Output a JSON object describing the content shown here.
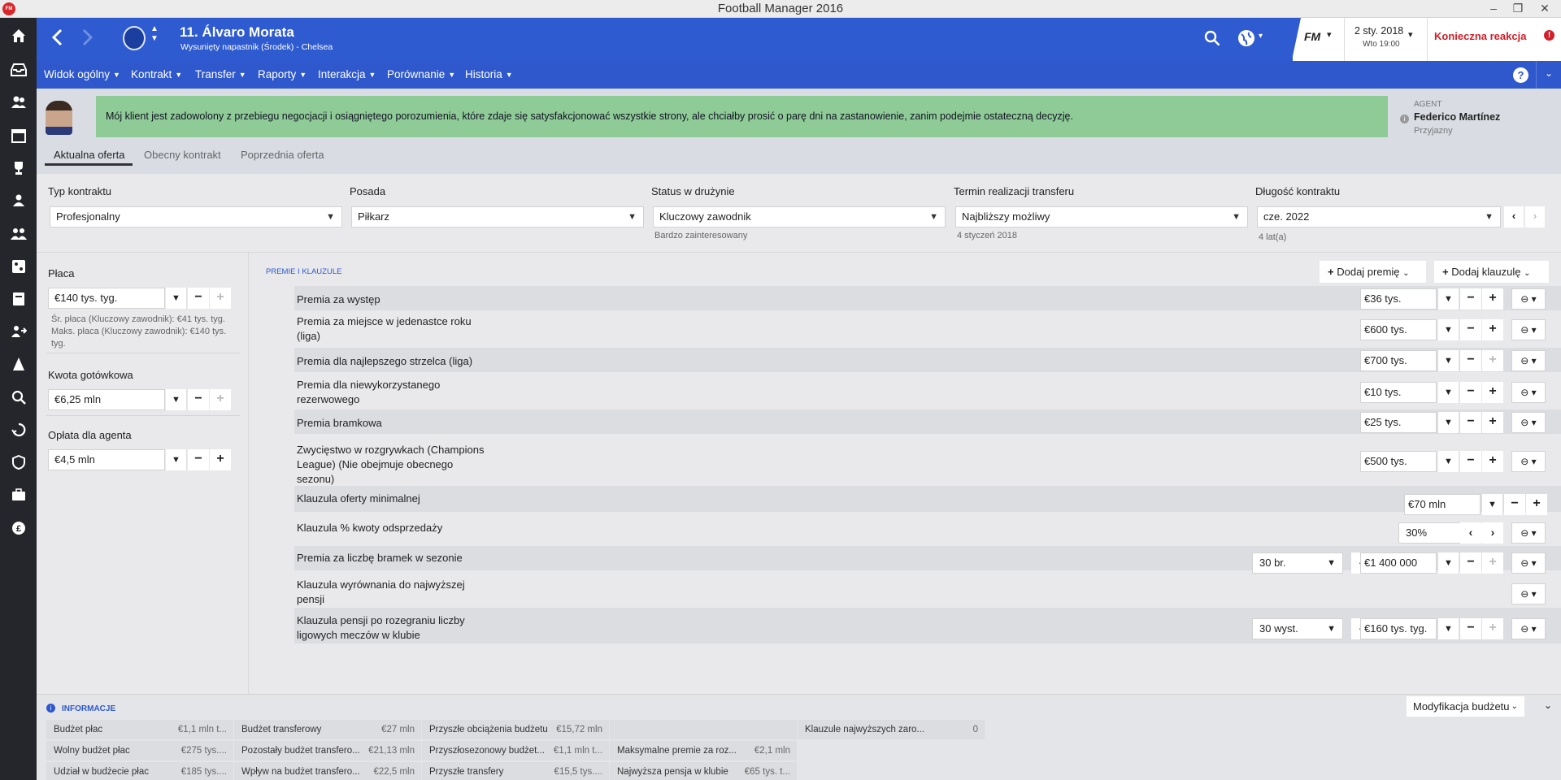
{
  "window": {
    "title": "Football Manager 2016",
    "app_icon": "FM"
  },
  "header": {
    "player_name": "11. Álvaro Morata",
    "player_sub": "Wysunięty napastnik (Środek) - Chelsea",
    "brand": "FM",
    "date": "2 sty. 2018",
    "time": "Wto 19:00",
    "alert": "Konieczna reakcja",
    "help": "?"
  },
  "nav": {
    "items": [
      "Widok ogólny",
      "Kontrakt",
      "Transfer",
      "Raporty",
      "Interakcja",
      "Porównanie",
      "Historia"
    ]
  },
  "message": {
    "text": "Mój klient jest zadowolony z przebiegu negocjacji i osiągniętego porozumienia, które zdaje się satysfakcjonować wszystkie strony, ale chciałby prosić o parę dni na zastanowienie, zanim podejmie ostateczną decyzję.",
    "agent_label": "AGENT",
    "agent_name": "Federico Martínez",
    "agent_mood": "Przyjazny"
  },
  "tabs": [
    "Aktualna oferta",
    "Obecny kontrakt",
    "Poprzednia oferta"
  ],
  "top_fields": [
    {
      "label": "Typ kontraktu",
      "value": "Profesjonalny",
      "note": ""
    },
    {
      "label": "Posada",
      "value": "Piłkarz",
      "note": ""
    },
    {
      "label": "Status w drużynie",
      "value": "Kluczowy zawodnik",
      "note": "Bardzo zainteresowany"
    },
    {
      "label": "Termin realizacji transferu",
      "value": "Najbliższy możliwy",
      "note": "4 styczeń 2018"
    },
    {
      "label": "Długość kontraktu",
      "value": "cze. 2022",
      "note": "4 lat(a)"
    }
  ],
  "left": {
    "wage_label": "Płaca",
    "wage": "€140 tys. tyg.",
    "wage_note": "Śr. płaca (Kluczowy zawodnik): €41 tys. tyg. Maks. płaca (Kluczowy zawodnik): €140 tys. tyg.",
    "cash_label": "Kwota gotówkowa",
    "cash": "€6,25 mln",
    "agent_fee_label": "Opłata dla agenta",
    "agent_fee": "€4,5 mln"
  },
  "bonuses": {
    "section_title": "PREMIE I KLAUZULE",
    "add_bonus": "Dodaj premię",
    "add_clause": "Dodaj klauzulę",
    "rows": [
      {
        "label": "Premia za występ",
        "value": "€36 tys."
      },
      {
        "label": "Premia za miejsce w jedenastce roku (liga)",
        "value": "€600 tys."
      },
      {
        "label": "Premia dla najlepszego strzelca (liga)",
        "value": "€700 tys."
      },
      {
        "label": "Premia dla niewykorzystanego rezerwowego",
        "value": "€10 tys."
      },
      {
        "label": "Premia bramkowa",
        "value": "€25 tys."
      },
      {
        "label": "Zwycięstwo w rozgrywkach (Champions League) (Nie obejmuje obecnego sezonu)",
        "value": "€500 tys."
      },
      {
        "label": "Klauzula oferty minimalnej",
        "value": "€70 mln"
      },
      {
        "label": "Klauzula % kwoty odsprzedaży",
        "value": "30%"
      },
      {
        "label": "Premia za liczbę bramek w sezonie",
        "value": "€1 400 000",
        "count": "30 br."
      },
      {
        "label": "Klauzula wyrównania do najwyższej pensji",
        "value": ""
      },
      {
        "label": "Klauzula pensji po rozegraniu liczby ligowych meczów w klubie",
        "value": "€160 tys. tyg.",
        "count": "30 wyst."
      }
    ]
  },
  "info": {
    "title": "INFORMACJE",
    "budget_button": "Modyfikacja budżetu",
    "cells": [
      {
        "label": "Budżet płac",
        "value": "€1,1 mln t..."
      },
      {
        "label": "Budżet transferowy",
        "value": "€27 mln"
      },
      {
        "label": "Przyszłe obciążenia budżetu",
        "value": "€15,72 mln"
      },
      {
        "label": "",
        "value": ""
      },
      {
        "label": "Klauzule najwyższych zaro...",
        "value": "0"
      },
      {
        "label": "Wolny budżet płac",
        "value": "€275 tys...."
      },
      {
        "label": "Pozostały budżet transfero...",
        "value": "€21,13 mln"
      },
      {
        "label": "Przyszłosezonowy budżet...",
        "value": "€1,1 mln t..."
      },
      {
        "label": "Maksymalne premie za roz...",
        "value": "€2,1 mln"
      },
      {
        "label": "Udział w budżecie płac",
        "value": "€185 tys...."
      },
      {
        "label": "Wpływ na budżet transfero...",
        "value": "€22,5 mln"
      },
      {
        "label": "Przyszłe transfery",
        "value": "€15,5 tys...."
      },
      {
        "label": "Najwyższa pensja w klubie",
        "value": "€65 tys. t..."
      }
    ]
  },
  "colors": {
    "topbar": "#2f5bd0",
    "sidebar": "#24262c",
    "message_bg": "#8fcb97",
    "accent_red": "#d0202a"
  }
}
